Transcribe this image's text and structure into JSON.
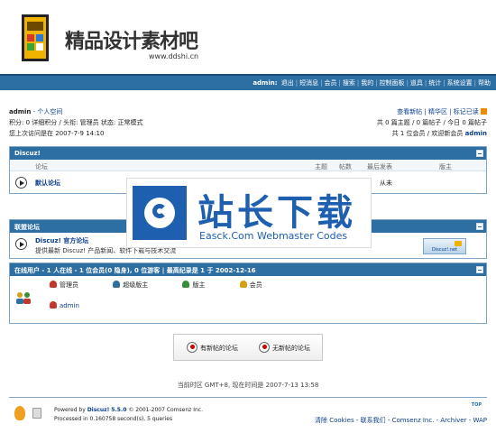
{
  "header": {
    "logo_title": "精品设计素材吧",
    "logo_url": "www.ddshi.cn"
  },
  "nav": {
    "user": "admin:",
    "items": [
      "退出",
      "短消息",
      "会员",
      "搜索",
      "我的",
      "控制面板",
      "道具",
      "统计",
      "系统设置",
      "帮助"
    ]
  },
  "userinfo": {
    "name": "admin",
    "space": "- 个人空间",
    "line2": "积分: 0 详细积分 / 头衔: 管理员 状态: 正常模式",
    "line3": "您上次访问是在 2007-7-9 14:10"
  },
  "rightinfo": {
    "line1": "查看新帖 | 精华区 | 标记已读",
    "line2": "共 0 篇主题 / 0 篇帖子 / 今日 0 篇帖子",
    "line3_prefix": "共 1 位会员 / 欢迎新会员",
    "line3_user": "admin"
  },
  "section_discuz": {
    "title": "Discuz!",
    "columns": {
      "forum": "论坛",
      "topics": "主题",
      "posts": "帖数",
      "last": "最后发表",
      "mod": "版主"
    },
    "forums": [
      {
        "name": "默认论坛",
        "last": "从未"
      }
    ]
  },
  "section_links": {
    "title": "联盟论坛",
    "items": [
      {
        "name": "Discuz! 官方论坛",
        "desc": "提供最新 Discuz! 产品新闻、软件下载与技术交流",
        "banner": "Discuz!.net"
      }
    ]
  },
  "section_online": {
    "title": "在线用户 - 1 人在线 - 1 位会员(0 隐身), 0 位游客 | 最高纪录是 1 于 2002-12-16",
    "legend": [
      "管理员",
      "超级版主",
      "版主",
      "会员"
    ],
    "users": [
      "admin"
    ],
    "legend_colors": [
      "#c0392b",
      "#2d6ea3",
      "#3a8e3a",
      "#d4a017"
    ]
  },
  "buttons": {
    "new_posts": "有新帖的论坛",
    "no_new_posts": "无新帖的论坛"
  },
  "timeinfo": "当前时区 GMT+8, 现在时间是 2007-7-13 13:58",
  "footer": {
    "top": "TOP",
    "powered_prefix": "Powered by",
    "powered_product": "Discuz!",
    "version": "5.5.0",
    "copyright": "© 2001-2007 Comsenz Inc.",
    "processed": "Processed in 0.160758 second(s), 5 queries",
    "links": "清除 Cookies - 联系我们 - Comsenz Inc. - Archiver - WAP"
  },
  "watermark": {
    "title": "站长下载",
    "subtitle": "Easck.Com Webmaster Codes"
  }
}
